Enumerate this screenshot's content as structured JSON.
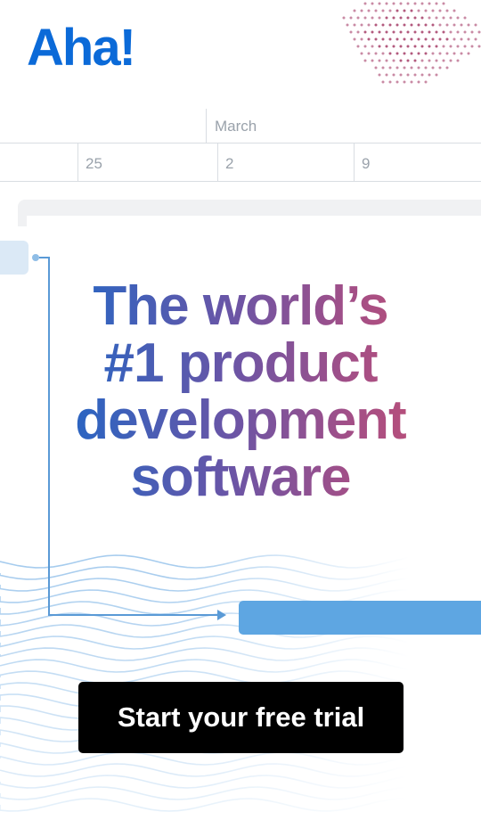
{
  "brand": {
    "logo_text": "Aha!",
    "logo_color": "#0b6ad8"
  },
  "timeline": {
    "month_label": "March",
    "ticks": [
      "25",
      "2",
      "9"
    ]
  },
  "headline": {
    "lines": [
      "The world’s",
      "#1 product",
      "development",
      "software"
    ]
  },
  "cta": {
    "label": "Start your free trial"
  },
  "colors": {
    "accent_blue": "#5ea6e2",
    "gradient_start": "#1d63c6",
    "gradient_end": "#cd4e6c",
    "cta_background": "#000000"
  }
}
